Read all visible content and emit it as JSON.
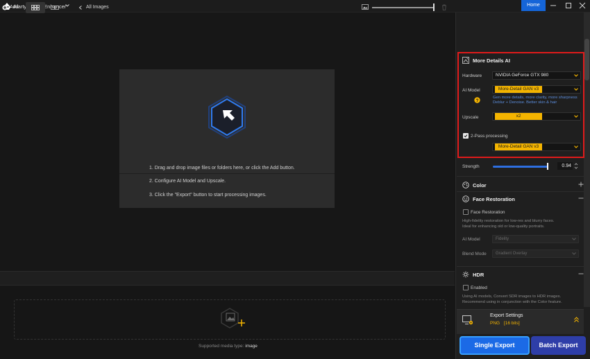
{
  "window": {
    "title": "Aiarty Image Enhancer",
    "home_label": "Home"
  },
  "workspace": {
    "steps": [
      "1. Drag and drop image files or folders here, or click the Add button.",
      "2. Configure AI Model and Upscale.",
      "3. Click the \"Export\" button to start processing images."
    ]
  },
  "bottombar": {
    "add_label": "Add",
    "all_images_label": "All Images"
  },
  "tray": {
    "media_type_label": "Supported media type:",
    "media_type_value": "image"
  },
  "more_details": {
    "title": "More Details AI",
    "hardware_label": "Hardware",
    "hardware_value": "NVIDIA GeForce GTX 980",
    "ai_model_label": "AI Model",
    "ai_model_value": "More-Detail GAN  v3",
    "ai_model_hint_line1": "Gen more details, more clarity, more sharpness",
    "ai_model_hint_line2": "Deblur + Denoise. Better skin & hair",
    "upscale_label": "Upscale",
    "upscale_value": "x2",
    "two_pass_label": "2-Pass processing",
    "two_pass_checked": true,
    "two_pass_model_value": "More-Detail GAN  v3",
    "strength_label": "Strength",
    "strength_value": "0.94",
    "strength_level": 0.94
  },
  "color": {
    "title": "Color"
  },
  "face_restoration": {
    "title": "Face Restoration",
    "checkbox_label": "Face Restoration",
    "checked": false,
    "desc_line1": "High-fidelity restoration for low-res and blurry faces.",
    "desc_line2": "Ideal for enhancing old or low-quality portraits.",
    "ai_model_label": "AI Model",
    "ai_model_value": "Fidelity",
    "blend_mode_label": "Blend Mode",
    "blend_mode_value": "Gradient Overlay"
  },
  "hdr": {
    "title": "HDR",
    "checkbox_label": "Enabled",
    "checked": false,
    "desc_line1": "Using AI models, Convert SDR images to HDR images.",
    "desc_line2": "Recommend using in conjunction with the Color feature."
  },
  "export": {
    "settings_label": "Export Settings",
    "format": "PNG",
    "bit_depth": "[16 bits]",
    "single_label": "Single Export",
    "batch_label": "Batch Export"
  },
  "colors": {
    "accent_blue": "#1b6ae6",
    "highlight_red": "#e21b1b",
    "chip_yellow": "#f4b400"
  }
}
